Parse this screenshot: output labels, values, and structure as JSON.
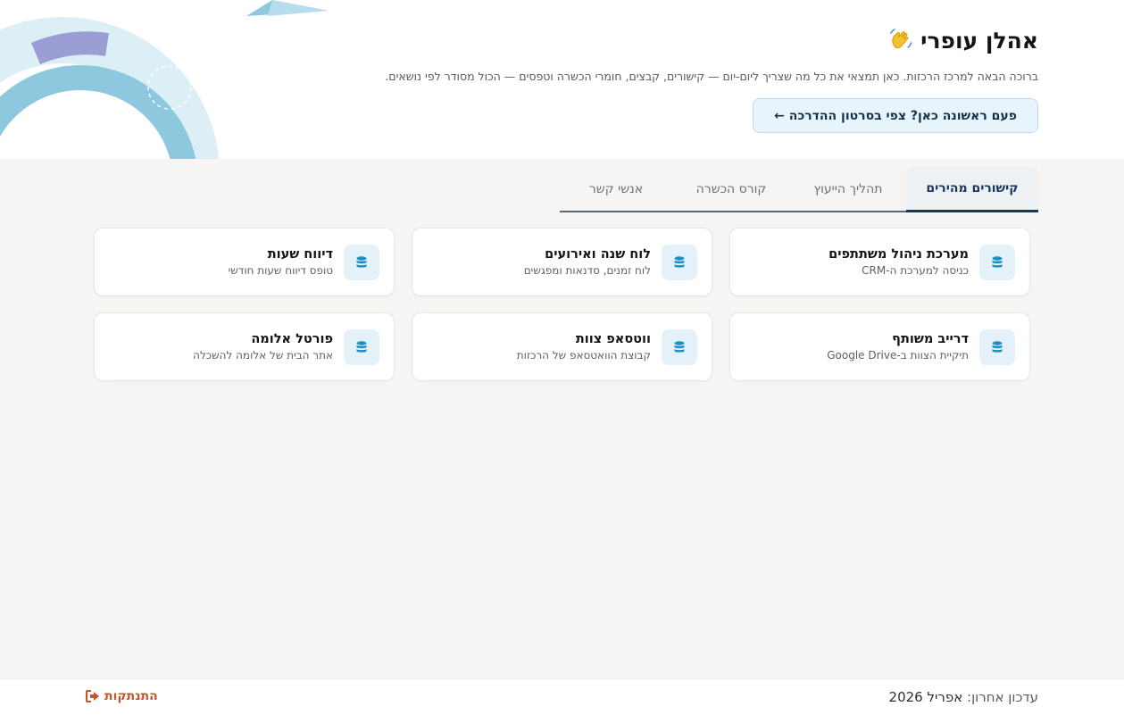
{
  "header": {
    "greeting": "אהלן עופרי",
    "greeting_icon": "waving-hand-icon",
    "subtitle": "ברוכה הבאה למרכז הרכזות. כאן תמצאי את כל מה שצריך ליום-יום — קישורים, קבצים, חומרי הכשרה וטפסים — הכול מסודר לפי נושאים.",
    "tutorial_button": "פעם ראשונה כאן? צפי בסרטון ההדרכה ←"
  },
  "tabs": [
    {
      "label": "קישורים מהירים",
      "active": true
    },
    {
      "label": "תהליך הייעוץ",
      "active": false
    },
    {
      "label": "קורס הכשרה",
      "active": false
    },
    {
      "label": "אנשי קשר",
      "active": false
    }
  ],
  "cards": [
    {
      "title": "מערכת ניהול משתתפים",
      "desc": "כניסה למערכת ה-CRM",
      "icon": "database-icon"
    },
    {
      "title": "לוח שנה ואירועים",
      "desc": "לוח זמנים, סדנאות ומפגשים",
      "icon": "database-icon"
    },
    {
      "title": "דיווח שעות",
      "desc": "טופס דיווח שעות חודשי",
      "icon": "database-icon"
    },
    {
      "title": "דרייב משותף",
      "desc": "תיקיית הצוות ב-Google Drive",
      "icon": "database-icon"
    },
    {
      "title": "ווטסאפ צוות",
      "desc": "קבוצת הוואטסאפ של הרכזות",
      "icon": "database-icon"
    },
    {
      "title": "פורטל אלומה",
      "desc": "אתר הבית של אלומה להשכלה",
      "icon": "database-icon"
    }
  ],
  "footer": {
    "updated_label": "עדכון אחרון:",
    "updated_value": "אפריל 2026",
    "logout": "התנתקות",
    "logout_icon": "logout-icon"
  },
  "colors": {
    "accent": "#17365a",
    "logout": "#c4552b",
    "icon": "#1d8fc7",
    "deco_blue": "#8ec8df",
    "deco_light": "#dceff7",
    "deco_purple": "#8f8fcf"
  }
}
